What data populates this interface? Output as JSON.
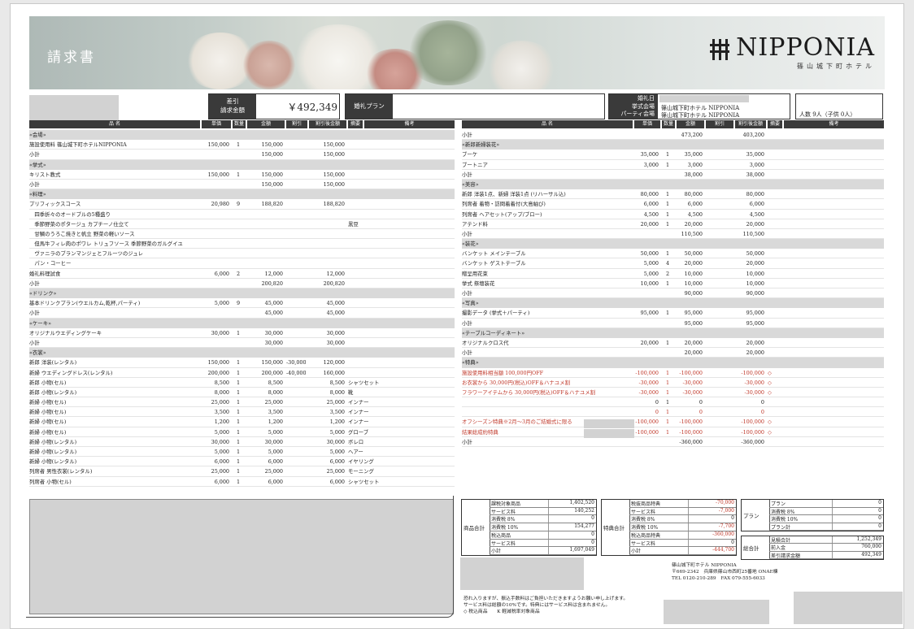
{
  "header": {
    "title": "請求書",
    "brand": "NIPPONIA",
    "brand_sub": "篠山城下町ホテル"
  },
  "summary": {
    "discount_label": "差引",
    "amount_label": "請求金額",
    "amount": "￥492,349",
    "plan_label": "婚礼プラン",
    "date_label": "婚礼日",
    "ceremony_label": "挙式会場",
    "party_label": "パーティ会場",
    "ceremony_venue": "篠山城下町ホテル NIPPONIA",
    "party_venue": "篠山城下町ホテル NIPPONIA",
    "guests": "人数 9人（子供 0人）"
  },
  "columns": [
    "品 名",
    "単価",
    "数量",
    "金額",
    "割引",
    "割引後金額",
    "摘要",
    "備考"
  ],
  "left_rows": [
    {
      "t": "sec",
      "n": "«会場»"
    },
    {
      "n": "施設使用料 篠山城下町ホテルNIPPONIA",
      "p": "150,000",
      "q": "1",
      "a": "150,000",
      "d": "",
      "f": "150,000",
      "m": ""
    },
    {
      "t": "sub",
      "n": "小計",
      "a": "150,000",
      "f": "150,000"
    },
    {
      "t": "sec",
      "n": "«挙式»"
    },
    {
      "n": "キリスト教式",
      "p": "150,000",
      "q": "1",
      "a": "150,000",
      "d": "",
      "f": "150,000",
      "m": ""
    },
    {
      "t": "sub",
      "n": "小計",
      "a": "150,000",
      "f": "150,000"
    },
    {
      "t": "sec",
      "n": "«料理»"
    },
    {
      "n": "プリフィックスコース",
      "p": "20,980",
      "q": "9",
      "a": "188,820",
      "d": "",
      "f": "188,820",
      "m": ""
    },
    {
      "n": "　四季折々のオードブルの5種盛り",
      "m": ""
    },
    {
      "n": "　季節野菜のポタージュ カプチーノ仕立て",
      "m": "黒豆"
    },
    {
      "n": "　甘鯛のうろこ焼きと帆立 野菜の軽いソース",
      "m": ""
    },
    {
      "n": "　但馬牛フィレ肉のポワレ トリュフソース 季節野菜のガルグイユ",
      "m": ""
    },
    {
      "n": "　ヴァニラのブランマンジェとフルーツのジュレ",
      "m": ""
    },
    {
      "n": "　パン・コーヒー",
      "m": ""
    },
    {
      "n": "婚礼料理試食",
      "p": "6,000",
      "q": "2",
      "a": "12,000",
      "d": "",
      "f": "12,000",
      "m": ""
    },
    {
      "t": "sub",
      "n": "小計",
      "a": "200,820",
      "f": "200,820"
    },
    {
      "t": "sec",
      "n": "«ドリンク»"
    },
    {
      "n": "基本ドリンクプラン(ウエルカム,乾杯,パーティ)",
      "p": "5,000",
      "q": "9",
      "a": "45,000",
      "d": "",
      "f": "45,000",
      "m": ""
    },
    {
      "t": "sub",
      "n": "小計",
      "a": "45,000",
      "f": "45,000"
    },
    {
      "t": "sec",
      "n": "«ケーキ»"
    },
    {
      "n": "オリジナルウエディングケーキ",
      "p": "30,000",
      "q": "1",
      "a": "30,000",
      "d": "",
      "f": "30,000",
      "m": ""
    },
    {
      "t": "sub",
      "n": "小計",
      "a": "30,000",
      "f": "30,000"
    },
    {
      "t": "sec",
      "n": "«衣裳»"
    },
    {
      "n": "新郎 洋装(レンタル)",
      "p": "150,000",
      "q": "1",
      "a": "150,000",
      "d": "-30,000",
      "f": "120,000",
      "m": ""
    },
    {
      "n": "新婦 ウエディングドレス(レンタル)",
      "p": "200,000",
      "q": "1",
      "a": "200,000",
      "d": "-40,000",
      "f": "160,000",
      "m": ""
    },
    {
      "n": "新郎 小物(セル)",
      "p": "8,500",
      "q": "1",
      "a": "8,500",
      "d": "",
      "f": "8,500",
      "m": "シャツセット"
    },
    {
      "n": "新郎 小物(レンタル)",
      "p": "8,000",
      "q": "1",
      "a": "8,000",
      "d": "",
      "f": "8,000",
      "m": "靴"
    },
    {
      "n": "新婦 小物(セル)",
      "p": "25,000",
      "q": "1",
      "a": "25,000",
      "d": "",
      "f": "25,000",
      "m": "インナー"
    },
    {
      "n": "新婦 小物(セル)",
      "p": "3,500",
      "q": "1",
      "a": "3,500",
      "d": "",
      "f": "3,500",
      "m": "インナー"
    },
    {
      "n": "新婦 小物(セル)",
      "p": "1,200",
      "q": "1",
      "a": "1,200",
      "d": "",
      "f": "1,200",
      "m": "インナー"
    },
    {
      "n": "新婦 小物(セル)",
      "p": "5,000",
      "q": "1",
      "a": "5,000",
      "d": "",
      "f": "5,000",
      "m": "グローブ"
    },
    {
      "n": "新婦 小物(レンタル)",
      "p": "30,000",
      "q": "1",
      "a": "30,000",
      "d": "",
      "f": "30,000",
      "m": "ボレロ"
    },
    {
      "n": "新婦 小物(レンタル)",
      "p": "5,000",
      "q": "1",
      "a": "5,000",
      "d": "",
      "f": "5,000",
      "m": "ヘアー"
    },
    {
      "n": "新婦 小物(レンタル)",
      "p": "6,000",
      "q": "1",
      "a": "6,000",
      "d": "",
      "f": "6,000",
      "m": "イヤリング"
    },
    {
      "n": "列席者 男性衣裳(レンタル)",
      "p": "25,000",
      "q": "1",
      "a": "25,000",
      "d": "",
      "f": "25,000",
      "m": "モーニング"
    },
    {
      "n": "列席者 小物(セル)",
      "p": "6,000",
      "q": "1",
      "a": "6,000",
      "d": "",
      "f": "6,000",
      "m": "シャツセット"
    }
  ],
  "right_rows": [
    {
      "t": "sub",
      "n": "小計",
      "a": "473,200",
      "f": "403,200"
    },
    {
      "t": "sec",
      "n": "«新郎新婦装花»"
    },
    {
      "n": "ブーケ",
      "p": "35,000",
      "q": "1",
      "a": "35,000",
      "d": "",
      "f": "35,000",
      "m": ""
    },
    {
      "n": "ブートニア",
      "p": "3,000",
      "q": "1",
      "a": "3,000",
      "d": "",
      "f": "3,000",
      "m": ""
    },
    {
      "t": "sub",
      "n": "小計",
      "a": "38,000",
      "f": "38,000"
    },
    {
      "t": "sec",
      "n": "«美容»"
    },
    {
      "n": "新郎 洋装1点、新婦 洋装1点 (リハーサル込)",
      "p": "80,000",
      "q": "1",
      "a": "80,000",
      "d": "",
      "f": "80,000",
      "m": ""
    },
    {
      "n": "列席者 着物・訪問着着付(大島紬び)",
      "p": "6,000",
      "q": "1",
      "a": "6,000",
      "d": "",
      "f": "6,000",
      "m": ""
    },
    {
      "n": "列席者 ヘアセット(アップ/ブロー)",
      "p": "4,500",
      "q": "1",
      "a": "4,500",
      "d": "",
      "f": "4,500",
      "m": ""
    },
    {
      "n": "アテンド料",
      "p": "20,000",
      "q": "1",
      "a": "20,000",
      "d": "",
      "f": "20,000",
      "m": ""
    },
    {
      "t": "sub",
      "n": "小計",
      "a": "110,500",
      "f": "110,500"
    },
    {
      "t": "sec",
      "n": "«装花»"
    },
    {
      "n": "バンケット メインテーブル",
      "p": "50,000",
      "q": "1",
      "a": "50,000",
      "d": "",
      "f": "50,000",
      "m": ""
    },
    {
      "n": "バンケット ゲストテーブル",
      "p": "5,000",
      "q": "4",
      "a": "20,000",
      "d": "",
      "f": "20,000",
      "m": ""
    },
    {
      "n": "贈呈用花束",
      "p": "5,000",
      "q": "2",
      "a": "10,000",
      "d": "",
      "f": "10,000",
      "m": ""
    },
    {
      "n": "挙式 祭壇装花",
      "p": "10,000",
      "q": "1",
      "a": "10,000",
      "d": "",
      "f": "10,000",
      "m": ""
    },
    {
      "t": "sub",
      "n": "小計",
      "a": "90,000",
      "f": "90,000"
    },
    {
      "t": "sec",
      "n": "«写真»"
    },
    {
      "n": "撮影データ (挙式＋パーティ)",
      "p": "95,000",
      "q": "1",
      "a": "95,000",
      "d": "",
      "f": "95,000",
      "m": ""
    },
    {
      "t": "sub",
      "n": "小計",
      "a": "95,000",
      "f": "95,000"
    },
    {
      "t": "sec",
      "n": "«テーブルコーディネート»"
    },
    {
      "n": "オリジナルクロス代",
      "p": "20,000",
      "q": "1",
      "a": "20,000",
      "d": "",
      "f": "20,000",
      "m": ""
    },
    {
      "t": "sub",
      "n": "小計",
      "a": "20,000",
      "f": "20,000"
    },
    {
      "t": "sec",
      "n": "«特典»"
    },
    {
      "t": "red",
      "n": "施設使用料相当額 100,000円OFF",
      "p": "-100,000",
      "q": "1",
      "a": "-100,000",
      "d": "",
      "f": "-100,000",
      "m": "◇"
    },
    {
      "t": "red",
      "n": "お衣裳から 30,000円(税込)OFF＆ハナユメ割",
      "p": "-30,000",
      "q": "1",
      "a": "-30,000",
      "d": "",
      "f": "-30,000",
      "m": "◇"
    },
    {
      "t": "red",
      "n": "フラワーアイテムから 30,000円(税込)OFF＆ハナユメ割",
      "p": "-30,000",
      "q": "1",
      "a": "-30,000",
      "d": "",
      "f": "-30,000",
      "m": "◇"
    },
    {
      "n": "",
      "p": "0",
      "q": "1",
      "a": "0",
      "d": "",
      "f": "0",
      "m": ""
    },
    {
      "t": "red",
      "n": "",
      "p": "0",
      "q": "1",
      "a": "0",
      "d": "",
      "f": "0",
      "m": ""
    },
    {
      "t": "red",
      "n": "オフシーズン特典※2月～3月のご結婚式に限る",
      "p": "-100,000",
      "q": "1",
      "a": "-100,000",
      "d": "",
      "f": "-100,000",
      "m": "◇"
    },
    {
      "t": "red",
      "n": "結果総成約特典",
      "p": "-100,000",
      "q": "1",
      "a": "-100,000",
      "d": "",
      "f": "-100,000",
      "m": "◇"
    },
    {
      "t": "sub",
      "n": "小計",
      "a": "-360,000",
      "f": "-360,000"
    }
  ],
  "product_totals": {
    "label": "商品合計",
    "rows": [
      {
        "k": "課税対象商品",
        "v": "1,402,520"
      },
      {
        "k": "サービス料",
        "v": "140,252"
      },
      {
        "k": "消費税 8%",
        "v": "0"
      },
      {
        "k": "消費税 10%",
        "v": "154,277"
      },
      {
        "k": "税込商品",
        "v": "0"
      },
      {
        "k": "サービス料",
        "v": "0"
      },
      {
        "k": "小計",
        "v": "1,697,049"
      }
    ]
  },
  "benefit_totals": {
    "label": "特典合計",
    "rows": [
      {
        "k": "税抜商品特典",
        "v": "-70,000"
      },
      {
        "k": "サービス料",
        "v": "-7,000"
      },
      {
        "k": "消費税 8%",
        "v": "0"
      },
      {
        "k": "消費税 10%",
        "v": "-7,700"
      },
      {
        "k": "税込商品特典",
        "v": "-360,000"
      },
      {
        "k": "サービス料",
        "v": "0"
      },
      {
        "k": "小計",
        "v": "-444,700"
      }
    ]
  },
  "plan_totals": {
    "label": "プラン",
    "rows": [
      {
        "k": "プラン",
        "v": "0"
      },
      {
        "k": "消費税 8%",
        "v": "0"
      },
      {
        "k": "消費税 10%",
        "v": "0"
      },
      {
        "k": "プラン計",
        "v": "0"
      }
    ]
  },
  "grand_totals": {
    "label": "総合計",
    "rows": [
      {
        "k": "見積合計",
        "v": "1,252,349"
      },
      {
        "k": "前入金",
        "v": "760,000"
      },
      {
        "k": "差引請求金額",
        "v": "492,349"
      }
    ]
  },
  "footer": {
    "hotel": "篠山城下町ホテル NIPPONIA",
    "address": "〒669-2342　兵庫県篠山市西町25番地 ONAE棟",
    "tel": "TEL 0120-210-289　FAX 079-555-6033",
    "note1": "恐れ入りますが、振込手数料はご負担いただきますようお願い申し上げます。",
    "note2": "サービス料は総額の10%です。特典にはサービス料は含まれません。",
    "note3": "◇ 税込商品　　K 軽減税率対象商品"
  },
  "colors": {
    "header_bg": "#3a3a3a",
    "section_bg": "#d9d9d9",
    "discount_red": "#c0392b",
    "redaction": "#d2d2d2"
  }
}
